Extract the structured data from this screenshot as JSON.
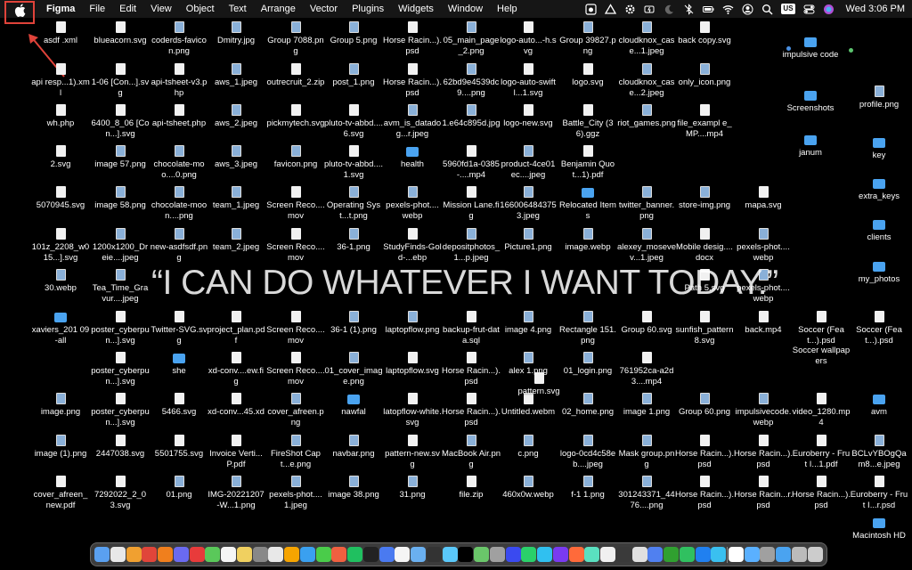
{
  "menubar": {
    "app_name": "Figma",
    "menus": [
      "File",
      "Edit",
      "View",
      "Object",
      "Text",
      "Arrange",
      "Vector",
      "Plugins",
      "Widgets",
      "Window",
      "Help"
    ],
    "input_source": "US",
    "clock": "Wed  3:06 PM"
  },
  "quote": "“I CAN DO WHATEVER I WANT TODAY.”",
  "desktop": {
    "columns": [
      [
        "asdf .xml",
        "api resp...1).xml",
        "wh.php",
        "2.svg",
        "5070945.svg",
        "101z_2208_w015...].svg",
        "30.webp",
        "xaviers_201 09-all",
        "",
        "image.png",
        "image (1).png",
        "cover_afreen_new.pdf"
      ],
      [
        "blueacorn.svg",
        "1-06 [Con...].svg",
        "6400_8_06 [Con...].svg",
        "image 57.png",
        "image 58.png",
        "1200x1200_Dreie....jpeg",
        "Tea_Time_Gravur....jpeg",
        "poster_cyberpun...].svg",
        "poster_cyberpun...].svg",
        "poster_cyberpun...].svg",
        "2447038.svg",
        "7292022_2_03.svg"
      ],
      [
        "coderds-favicon.png",
        "api-tsheet-v3.php",
        "api-tsheet.php",
        "chocolate-moo....0.png",
        "chocolate-moon....png",
        "new-asdfsdf.png",
        "",
        "Twitter-SVG.svg",
        "she",
        "5466.svg",
        "5501755.svg",
        "01.png"
      ],
      [
        "Dmitry.jpg",
        "aws_1.jpeg",
        "aws_2.jpeg",
        "aws_3.jpeg",
        "team_1.jpeg",
        "team_2.jpeg",
        "",
        "project_plan.pdf",
        "xd-conv....ew.fig",
        "xd-conv...45.xd",
        "Invoice Verti...P.pdf",
        "IMG-20221207-W...1.png"
      ],
      [
        "Group 7088.png",
        "outrecruit_2.zip",
        "pickmytech.svg",
        "favicon.png",
        "Screen Reco....mov",
        "Screen Reco....mov",
        "",
        "Screen Reco....mov",
        "Screen Reco....mov",
        "cover_afreen.png",
        "FireShot Capt...e.png",
        "pexels-phot....1.jpeg"
      ],
      [
        "Group 5.png",
        "post_1.png",
        "pluto-tv-abbd....6.svg",
        "pluto-tv-abbd....1.svg",
        "Operating Syst...t.png",
        "36-1.png",
        "",
        "36-1 (1).png",
        "01_cover_image.png",
        "nawfal",
        "navbar.png",
        "image 38.png"
      ],
      [
        "Horse Racin...).psd",
        "Horse Racin...).psd",
        "avm_is_datadog...r.jpeg",
        "health",
        "pexels-phot....webp",
        "StudyFinds-Gold-...ebp",
        "",
        "laptopflow.png",
        "laptopflow.svg",
        "latopflow-white.svg",
        "pattern-new.svg",
        "31.png"
      ],
      [
        "05_main_page_2.png",
        "62bd9e4539dc9....png",
        "1.e64c895d.jpg",
        "5960fd1a-0385-....mp4",
        "Mission Lane.fig",
        "depositphotos_1...p.jpeg",
        "",
        "backup-frut-data.sql",
        "Horse Racin...).psd",
        "Horse Racin...).psd",
        "MacBook Air.png",
        "file.zip"
      ],
      [
        "logo-auto...-h.svg",
        "logo-auto-swiftl...1.svg",
        "logo-new.svg",
        "product-4ce01ec....jpeg",
        "1660064843753.jpeg",
        "Picture1.png",
        "",
        "image 4.png",
        "alex 1.png",
        "Untitled.webm",
        "c.png",
        "460x0w.webp"
      ],
      [
        "Group 39827.png",
        "logo.svg",
        "Battle_City (36).ggz",
        "Benjamin Quot...1).pdf",
        "Relocated Items",
        "image.webp",
        "",
        "Rectangle 151.png",
        "01_login.png",
        "02_home.png",
        "logo-0cd4c58eb....jpeg",
        "f-1 1.png"
      ],
      [
        "cloudknox_case...1.jpeg",
        "cloudknox_case...2.jpeg",
        "riot_games.png",
        "",
        "twitter_banner.png",
        "alexey_mosevev...1.jpeg",
        "",
        "Group 60.svg",
        "761952ca-a2d3....mp4",
        "image 1.png",
        "Mask group.png",
        "301243371_4476....png"
      ],
      [
        "back copy.svg",
        "only_icon.png",
        "file_exampl e_MP....mp4",
        "",
        "store-img.png",
        "Mobile desig....docx",
        "Path 5.svg",
        "sunfish_pattern8.svg",
        "",
        "Group 60.png",
        "Horse Racin...).psd",
        "Horse Racin...).psd"
      ]
    ],
    "extra": {
      "col13": [
        "mapa.svg",
        "pexels-phot....webp",
        "pexels-phot....webp",
        "back.mp4",
        "impulsivecode.webp",
        "Horse Racin...).psd",
        "Horse Racin...r.psd"
      ],
      "col14": [
        "Soccer (Feat...).psd",
        "Soccer wallpapers",
        "video_1280.mp4",
        "Euroberry - Frut I...1.pdf",
        "Horse Racin...).psd"
      ],
      "col15": [
        "Soccer (Feat...).psd",
        "avm",
        "BCLvYBOgQam8...e.jpeg",
        "Euroberry - Frut I...r.psd"
      ],
      "right_top": [
        "impulsive code",
        "Screenshots",
        "janum"
      ],
      "right_col": [
        "profile.png",
        "key",
        "extra_keys",
        "clients",
        "my_photos",
        "Macintosh HD"
      ],
      "pattern": "pattern.svg"
    }
  },
  "colors": {
    "highlight": "#e0433a",
    "folder": "#4aa3f0"
  },
  "dock_count": 46
}
